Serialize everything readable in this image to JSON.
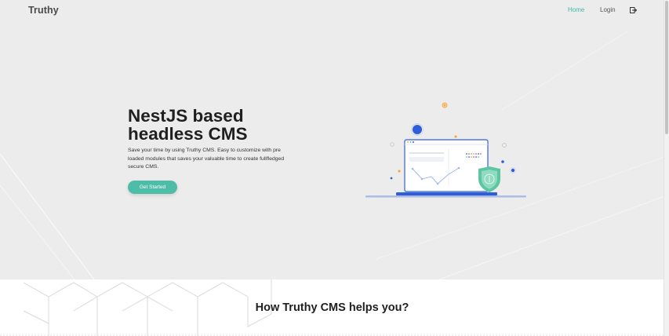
{
  "brand": {
    "name": "Truthy"
  },
  "nav": {
    "items": [
      {
        "label": "Home",
        "active": true
      },
      {
        "label": "Login",
        "active": false
      }
    ],
    "icon": "login-enter-icon"
  },
  "hero": {
    "title_line1": "NestJS based",
    "title_line2": "headless CMS",
    "description": "Save your time by using Truthy CMS. Easy to customize with pre loaded modules that saves your valuable time to create fullfledged secure CMS.",
    "cta_label": "Get Started"
  },
  "section": {
    "title": "How Truthy CMS helps you?"
  },
  "colors": {
    "accent": "#4dbda8",
    "hero_bg": "#ececec",
    "illustration_blue": "#2f5fd8",
    "shield_green": "#5cc6a3"
  }
}
